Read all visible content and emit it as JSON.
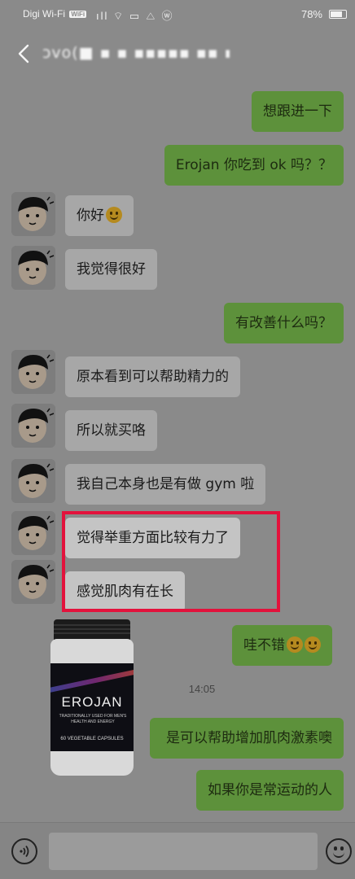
{
  "status_bar": {
    "carrier": "Digi Wi-Fi",
    "wifi_badge": "WiFi",
    "icons": "ıll ⌔ ▭ △ ⓦ",
    "battery": "78%"
  },
  "header": {
    "back_icon": "chevron-left-icon",
    "contact_name": "ɔvo(■ ▪ ▪ ▪▪▪▪▪ ▪▪ ▪"
  },
  "messages": [
    {
      "side": "out",
      "text": "想跟进一下"
    },
    {
      "side": "out",
      "text": "Erojan 你吃到 ok 吗？？"
    },
    {
      "side": "in",
      "text": "你好",
      "emoji": "smile"
    },
    {
      "side": "in",
      "text": "我觉得很好"
    },
    {
      "side": "out",
      "text": "有改善什么吗？"
    },
    {
      "side": "in",
      "text": "原本看到可以帮助精力的"
    },
    {
      "side": "in",
      "text": "所以就买咯"
    },
    {
      "side": "in",
      "text": "我自己本身也是有做 gym 啦"
    },
    {
      "side": "in",
      "text": "觉得举重方面比较有力了",
      "highlighted": true
    },
    {
      "side": "in",
      "text": "感觉肌肉有在长",
      "highlighted": true
    },
    {
      "side": "out",
      "text": "哇不错",
      "emoji_count": 2
    },
    {
      "side": "out",
      "text": "是可以帮助增加肌肉激素噢"
    },
    {
      "side": "out",
      "text": "如果你是常运动的人"
    }
  ],
  "timestamp": "14:05",
  "product": {
    "brand": "EROJAN",
    "tagline": "TRADITIONALLY USED FOR MEN'S HEALTH AND ENERGY",
    "count": "60 VEGETABLE CAPSULES"
  },
  "input_bar": {
    "voice_icon": "voice-icon",
    "emoji_icon": "smiley-icon",
    "placeholder": ""
  },
  "colors": {
    "bubble_out": "#5d913b",
    "bubble_in": "#a7a7a7",
    "highlight_border": "#e3123c"
  }
}
